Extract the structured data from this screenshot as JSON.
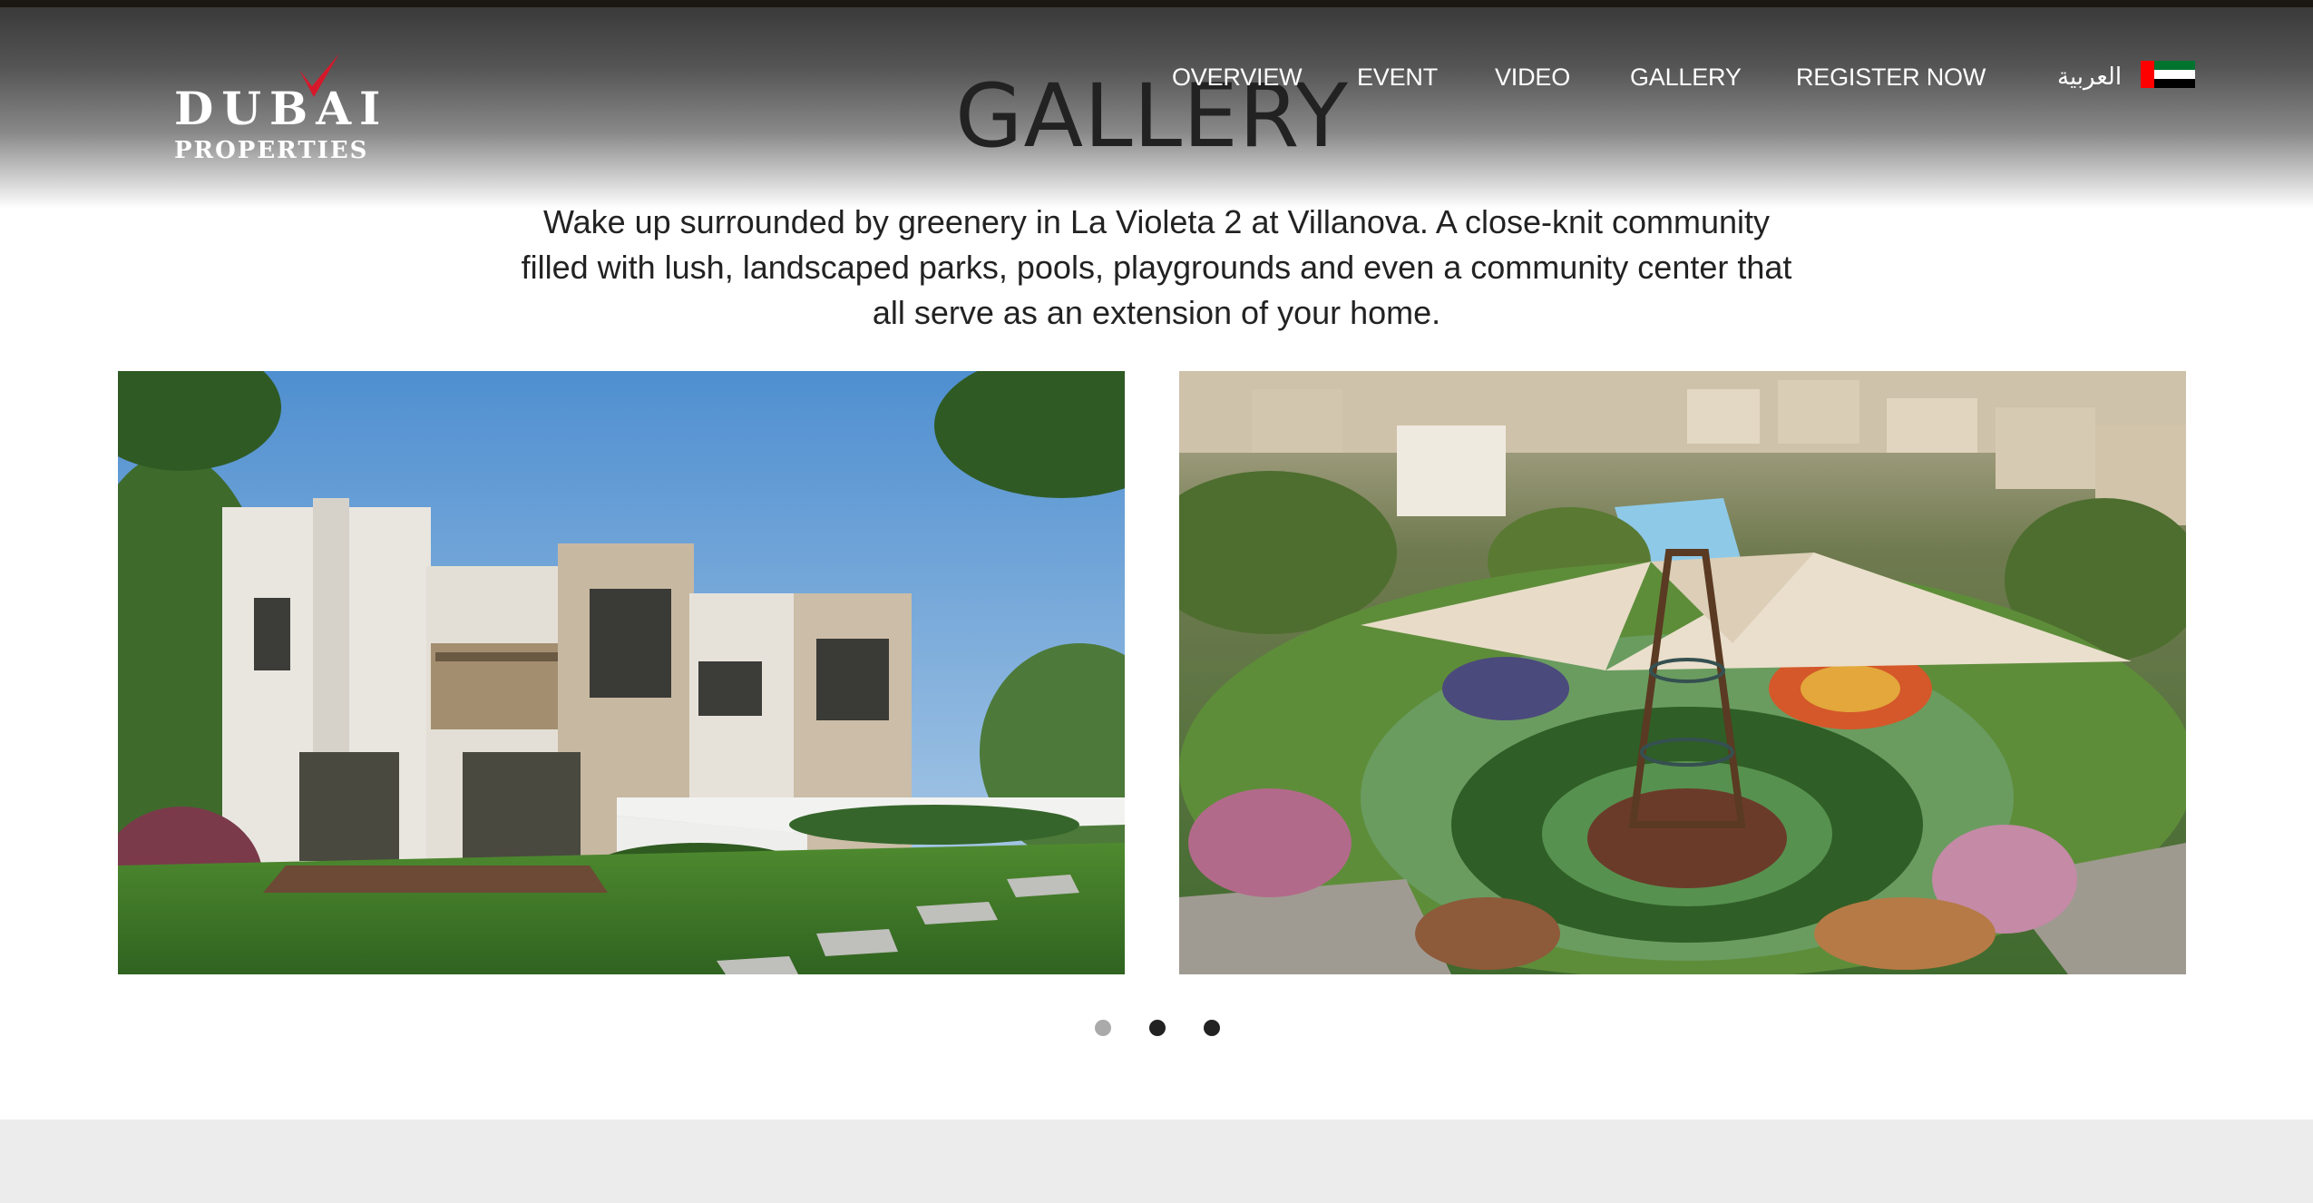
{
  "logo": {
    "line1": "DUBAI",
    "line2": "PROPERTIES",
    "accent_color": "#d6192a"
  },
  "nav": {
    "items": [
      {
        "label": "OVERVIEW"
      },
      {
        "label": "EVENT"
      },
      {
        "label": "VIDEO"
      },
      {
        "label": "GALLERY"
      },
      {
        "label": "REGISTER NOW"
      }
    ],
    "language": "العربية",
    "flag_icon": "uae-flag-icon"
  },
  "gallery": {
    "title": "GALLERY",
    "intro": "Wake up surrounded by greenery in La Violeta 2 at Villanova. A close-knit community filled with lush, landscaped parks, pools, playgrounds and even a community center that all serve as an extension of your home.",
    "slides": [
      {
        "alt": "townhouses-render"
      },
      {
        "alt": "playground-park-render"
      }
    ],
    "pagination": {
      "count": 3,
      "active": 1
    }
  }
}
